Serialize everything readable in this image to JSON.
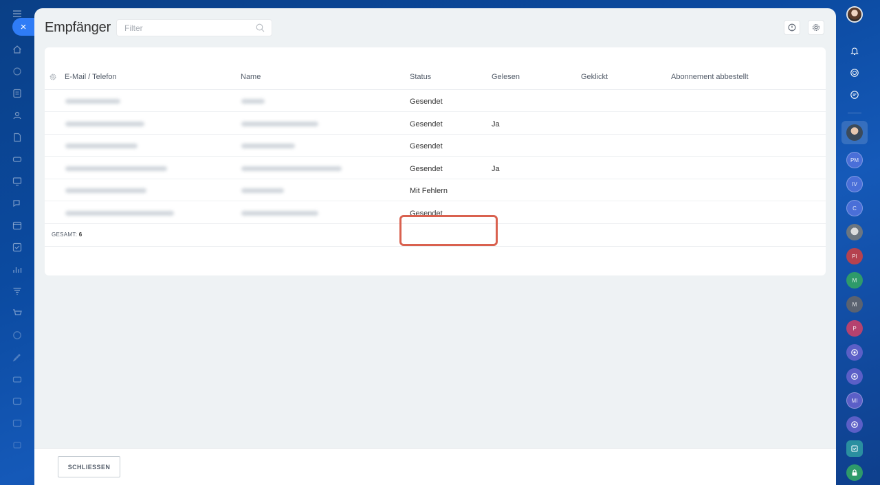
{
  "left_sidebar": {
    "icons": [
      "menu-icon",
      "home-icon",
      "feed-icon",
      "tasks-icon",
      "contacts-icon",
      "docs-icon",
      "drive-icon",
      "sites-icon",
      "chat-icon",
      "calendar-icon",
      "checkbox-icon",
      "analytics-icon",
      "funnel-icon",
      "cart-icon",
      "marketing-icon",
      "sign-icon",
      "groups-icon",
      "inbox-icon",
      "calendar2-icon",
      "more-icon"
    ]
  },
  "slider": {
    "close_symbol": "×",
    "title": "Empfänger",
    "filter_placeholder": "Filter"
  },
  "table": {
    "columns": [
      "E-Mail / Telefon",
      "Name",
      "Status",
      "Gelesen",
      "Geklickt",
      "Abonnement abbestellt"
    ],
    "rows": [
      {
        "status": "Gesendet",
        "read": ""
      },
      {
        "status": "Gesendet",
        "read": "Ja"
      },
      {
        "status": "Gesendet",
        "read": ""
      },
      {
        "status": "Gesendet",
        "read": "Ja"
      },
      {
        "status": "Mit Fehlern",
        "read": ""
      },
      {
        "status": "Gesendet",
        "read": ""
      }
    ],
    "total_label": "GESAMT:",
    "total_value": "6"
  },
  "footer": {
    "close_button": "SCHLIESSEN"
  },
  "right_sidebar": {
    "avatars": [
      "PM",
      "IV",
      "C",
      "PI",
      "M",
      "M",
      "P",
      "MI"
    ],
    "colors": {
      "pm": "#4a6fd8",
      "iv": "#4a6fd8",
      "c": "#4a6fd8",
      "pi": "#b5424f",
      "m1": "#2e9a6a",
      "m2": "#5a6270",
      "p": "#b5426f",
      "mi": "#5b5fc7"
    }
  },
  "colors": {
    "accent": "#2f7cf6",
    "highlight": "#d9614f",
    "panel_bg": "#eef2f4"
  }
}
